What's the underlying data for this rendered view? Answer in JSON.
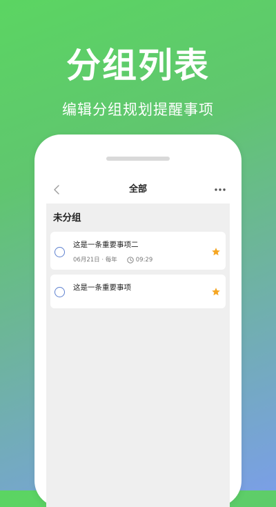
{
  "hero": {
    "title": "分组列表",
    "subtitle": "编辑分组规划提醒事项"
  },
  "nav": {
    "title": "全部"
  },
  "group": {
    "title": "未分组"
  },
  "tasks": [
    {
      "title": "这是一条重要事项二",
      "date_repeat": "06月21日 · 每年",
      "time": "09:29",
      "starred": true
    },
    {
      "title": "这是一条重要事项",
      "starred": true
    }
  ],
  "colors": {
    "accent_circle": "#5b7fcf",
    "star": "#f5a623",
    "background_top": "#5bd562",
    "background_bottom": "#7a9fe6"
  },
  "icons": {
    "back": "chevron-left-icon",
    "more": "more-horizontal-icon",
    "clock": "clock-icon",
    "star": "star-icon",
    "check": "circle-icon"
  }
}
